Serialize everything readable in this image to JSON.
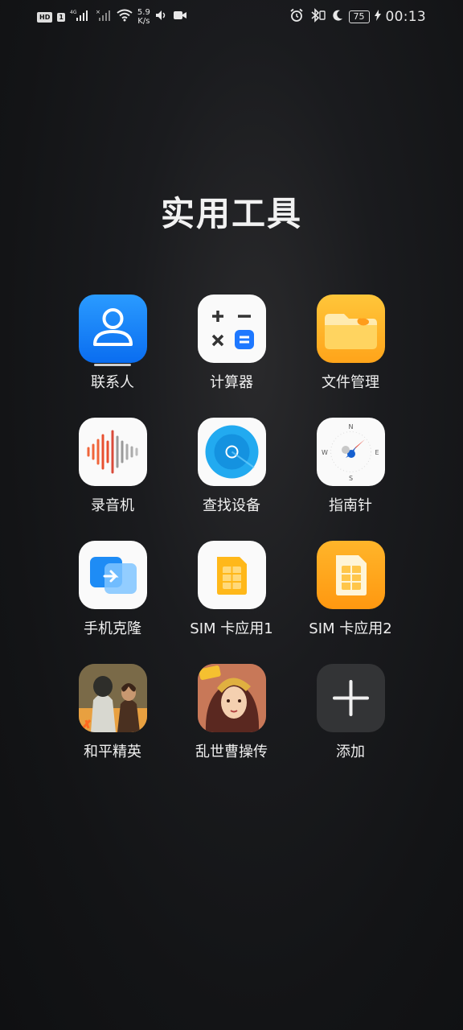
{
  "status_bar": {
    "hd_badge": "HD",
    "sim_badge": "1",
    "network_type": "4G",
    "net_speed_value": "5.9",
    "net_speed_unit": "K/s",
    "battery": "75",
    "time": "00:13"
  },
  "folder": {
    "title": "实用工具"
  },
  "apps": [
    {
      "label": "联系人",
      "icon": "contacts-icon"
    },
    {
      "label": "计算器",
      "icon": "calculator-icon"
    },
    {
      "label": "文件管理",
      "icon": "files-icon"
    },
    {
      "label": "录音机",
      "icon": "recorder-icon"
    },
    {
      "label": "查找设备",
      "icon": "find-device-icon"
    },
    {
      "label": "指南针",
      "icon": "compass-icon"
    },
    {
      "label": "手机克隆",
      "icon": "phone-clone-icon"
    },
    {
      "label": "SIM 卡应用1",
      "icon": "sim1-icon"
    },
    {
      "label": "SIM 卡应用2",
      "icon": "sim2-icon"
    },
    {
      "label": "和平精英",
      "icon": "game-peace-elite-icon"
    },
    {
      "label": "乱世曹操传",
      "icon": "game-cao-cao-icon"
    },
    {
      "label": "添加",
      "icon": "add-icon"
    }
  ],
  "colors": {
    "contacts": "#0a6df0",
    "files": "#ffa41a",
    "sim2": "#ff9810",
    "accent_blue": "#1e78ff"
  }
}
